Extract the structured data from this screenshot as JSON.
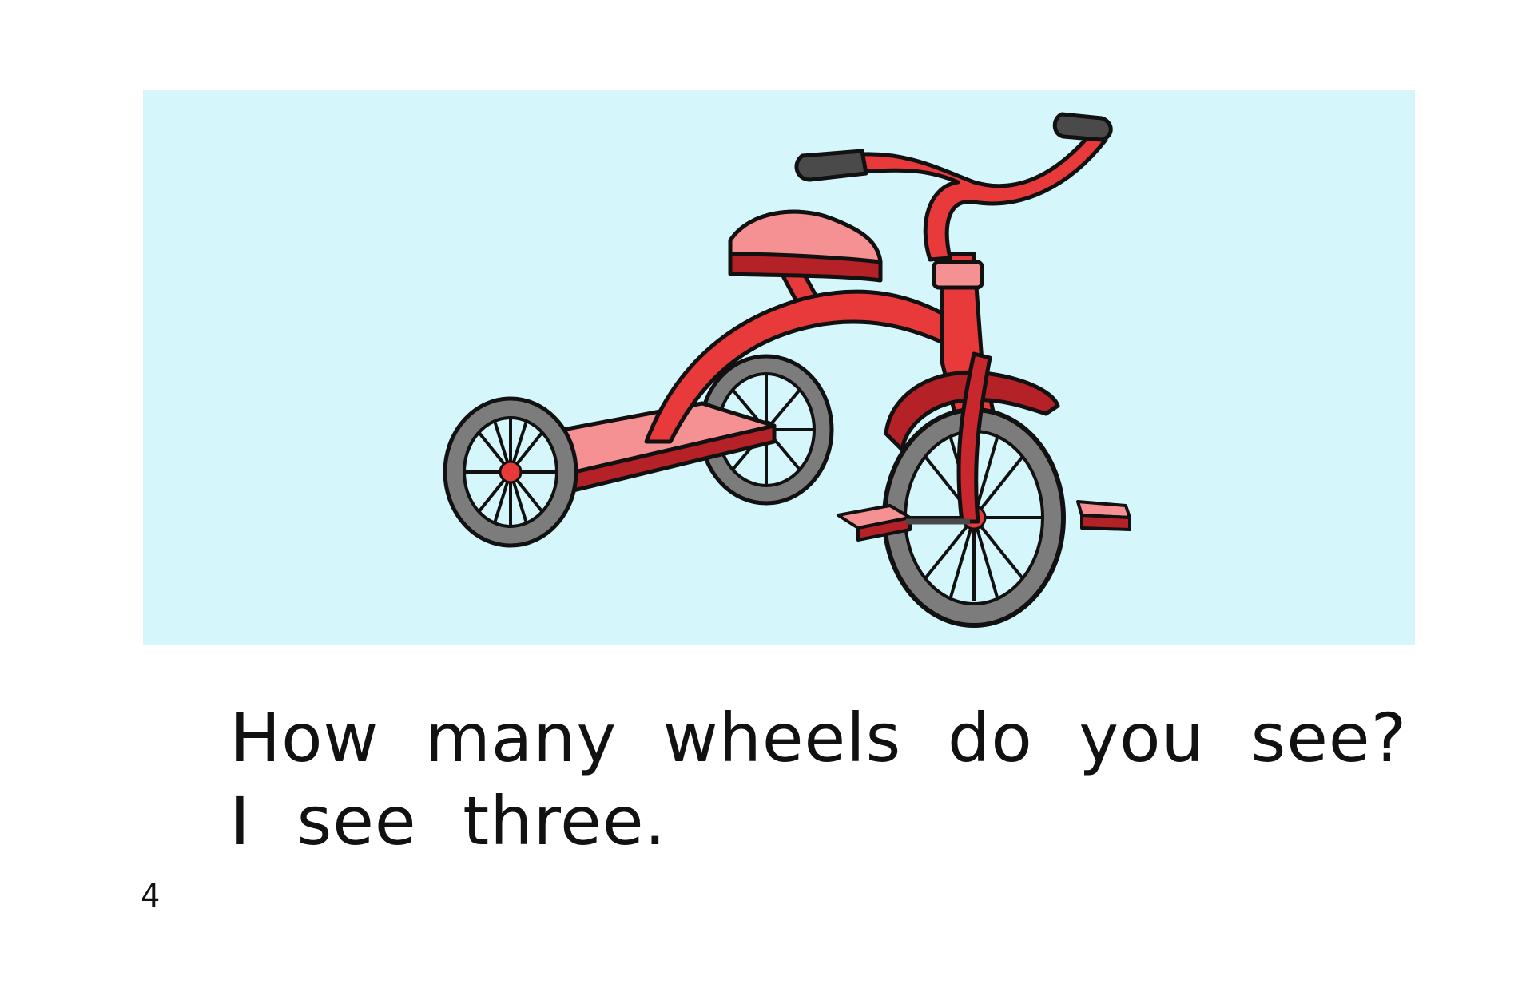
{
  "page": {
    "background_color": "#ffffff",
    "number": "4"
  },
  "illustration": {
    "subject": "tricycle-icon",
    "colors": {
      "sky": "#d5f7fb",
      "frame_red": "#e8393b",
      "frame_dark_red": "#b42126",
      "deck_pink": "#f59093",
      "tire_gray": "#7c7c7c",
      "grip_dark": "#4a4a4a",
      "outline": "#111111"
    }
  },
  "story": {
    "line_1": "How many wheels do you see?",
    "line_2": "I see three."
  }
}
